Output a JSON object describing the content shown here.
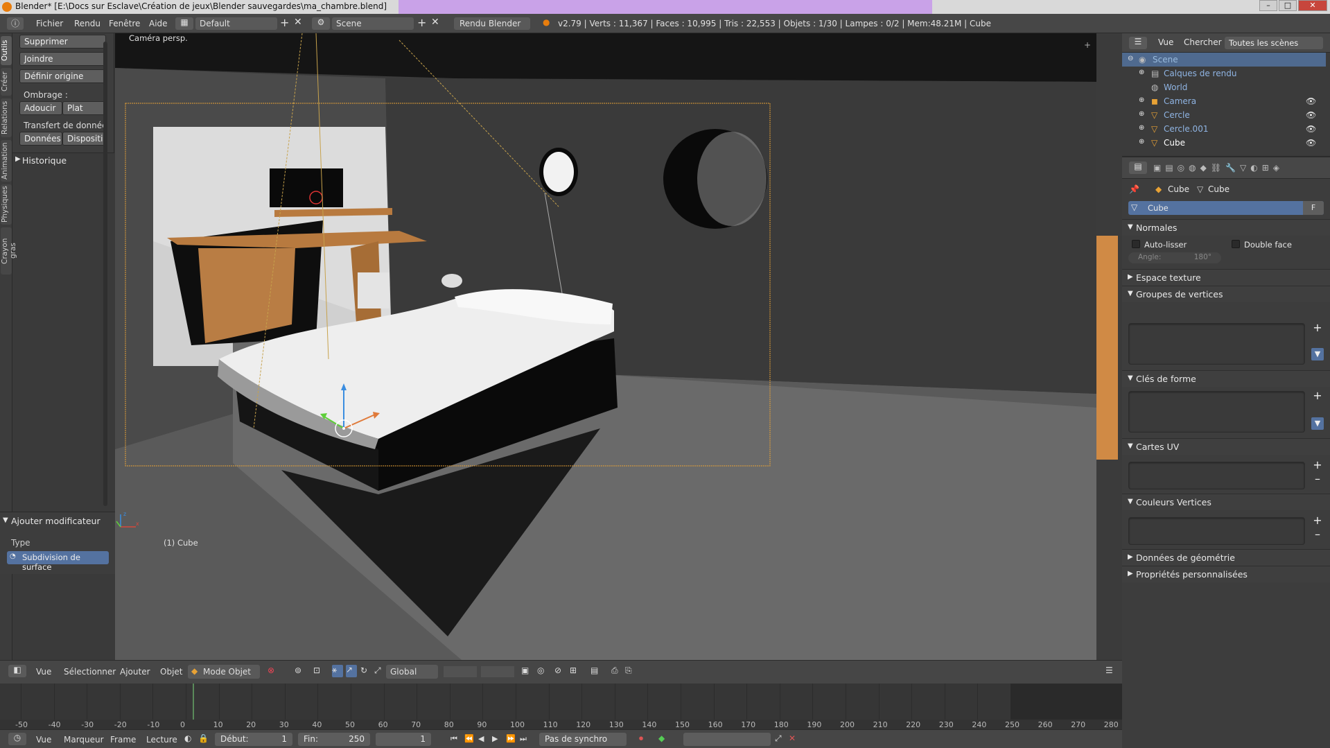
{
  "titlebar": {
    "title": "Blender* [E:\\Docs sur Esclave\\Création de jeux\\Blender sauvegardes\\ma_chambre.blend]",
    "win_min": "–",
    "win_max": "□",
    "win_close": "✕"
  },
  "infobar": {
    "menus": [
      "Fichier",
      "Rendu",
      "Fenêtre",
      "Aide"
    ],
    "layout": "Default",
    "scene": "Scene",
    "engine": "Rendu Blender",
    "stats": "v2.79 | Verts : 11,367 | Faces : 10,995 | Tris : 22,553 | Objets : 1/30 | Lampes : 0/2 | Mem:48.21M | Cube"
  },
  "tool_tabs": [
    "Outils",
    "Créer",
    "Relations",
    "Animation",
    "Physiques",
    "Crayon gras"
  ],
  "toolshelf": {
    "supprimer": "Supprimer",
    "joindre": "Joindre",
    "definir_origine": "Définir origine",
    "ombrage": "Ombrage :",
    "adoucir": "Adoucir",
    "plat": "Plat",
    "transfert": "Transfert de donnée",
    "donnees": "Données",
    "dispositi": "Dispositi",
    "historique": "Historique"
  },
  "operator_panel": {
    "title": "Ajouter modificateur",
    "type_label": "Type",
    "type_value": "Subdivision de surface"
  },
  "viewport": {
    "view_label": "Caméra persp.",
    "object_label": "(1) Cube"
  },
  "viewport_header": {
    "menus": [
      "Vue",
      "Sélectionner",
      "Ajouter",
      "Objet"
    ],
    "mode": "Mode Objet",
    "orientation": "Global"
  },
  "timeline": {
    "ticks": [
      "-50",
      "-40",
      "-30",
      "-20",
      "-10",
      "0",
      "10",
      "20",
      "30",
      "40",
      "50",
      "60",
      "70",
      "80",
      "90",
      "100",
      "110",
      "120",
      "130",
      "140",
      "150",
      "160",
      "170",
      "180",
      "190",
      "200",
      "210",
      "220",
      "230",
      "240",
      "250",
      "260",
      "270",
      "280"
    ],
    "current_frame": "1"
  },
  "timeline_header": {
    "menus": [
      "Vue",
      "Marqueur",
      "Frame",
      "Lecture"
    ],
    "debut_label": "Début:",
    "debut_value": "1",
    "fin_label": "Fin:",
    "fin_value": "250",
    "frame_value": "1",
    "sync": "Pas de synchro"
  },
  "outliner": {
    "menus": [
      "Vue",
      "Chercher"
    ],
    "filter": "Toutes les scènes",
    "items": [
      {
        "name": "Scene",
        "type": "scene-icon"
      },
      {
        "name": "Calques de rendu",
        "type": "render-layers-icon"
      },
      {
        "name": "World",
        "type": "world-icon"
      },
      {
        "name": "Camera",
        "type": "camera-icon"
      },
      {
        "name": "Cercle",
        "type": "mesh-icon"
      },
      {
        "name": "Cercle.001",
        "type": "mesh-icon"
      },
      {
        "name": "Cube",
        "type": "mesh-icon"
      }
    ]
  },
  "properties": {
    "breadcrumb_object": "Cube",
    "breadcrumb_data": "Cube",
    "data_name": "Cube",
    "fake_user": "F",
    "normales": "Normales",
    "auto_lisser": "Auto-lisser",
    "double_face": "Double face",
    "angle_label": "Angle:",
    "angle_value": "180°",
    "espace_texture": "Espace texture",
    "groupes_vertices": "Groupes de vertices",
    "cles_forme": "Clés de forme",
    "cartes_uv": "Cartes UV",
    "couleurs_vertices": "Couleurs Vertices",
    "donnees_geometrie": "Données de géométrie",
    "proprietes_perso": "Propriétés personnalisées"
  },
  "colors": {
    "accent_orange": "#e8a235",
    "selection_blue": "#4f6a8f",
    "panel": "#3d3d3d"
  }
}
